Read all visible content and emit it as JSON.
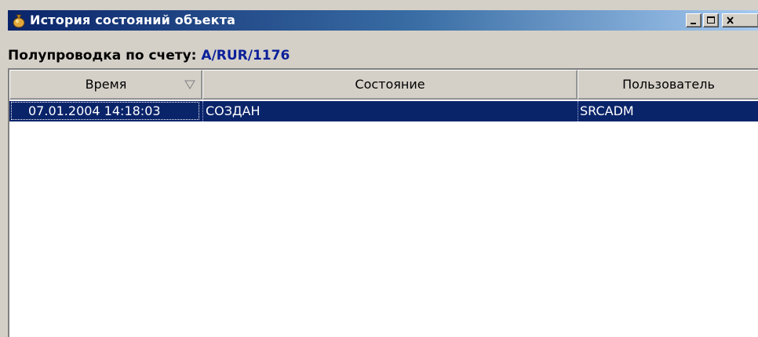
{
  "window": {
    "title": "История состояний объекта",
    "buttons": {
      "minimize_icon": "minimize-icon",
      "maximize_icon": "maximize-icon",
      "close_icon": "close-icon"
    }
  },
  "caption": {
    "label": "Полупроводка по счету:",
    "account": "A/RUR/1176"
  },
  "grid": {
    "columns": [
      {
        "label": "Время",
        "sort_icon": "sort-descending-icon"
      },
      {
        "label": "Состояние"
      },
      {
        "label": "Пользователь"
      }
    ],
    "rows": [
      {
        "time": "07.01.2004 14:18:03",
        "state": "СОЗДАН",
        "user": "SRCADM",
        "selected": true
      }
    ]
  },
  "colors": {
    "titlebar_start": "#0a246a",
    "titlebar_end": "#a6caf0",
    "selection": "#0a246a",
    "account_text": "#0a1f9a",
    "face": "#d4d0c8"
  }
}
